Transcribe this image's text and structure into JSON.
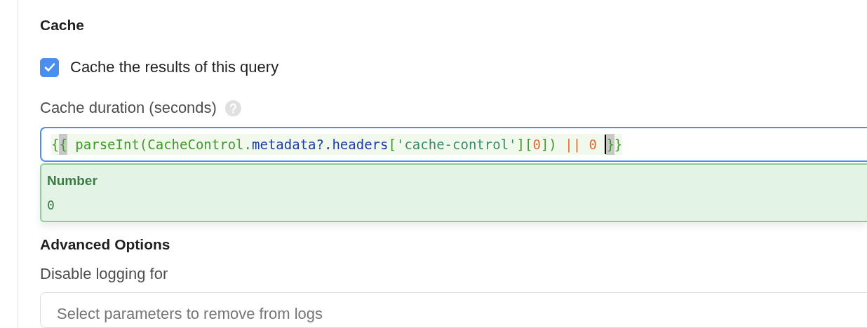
{
  "cache_section": {
    "heading": "Cache",
    "checkbox": {
      "label": "Cache the results of this query",
      "checked": true
    },
    "duration": {
      "label": "Cache duration (seconds)",
      "tokens": [
        {
          "text": "{",
          "kind": "brace",
          "matched": false,
          "cursor_before": false
        },
        {
          "text": "{",
          "kind": "brace",
          "matched": true,
          "cursor_before": false
        },
        {
          "text": " parseInt(CacheControl.",
          "kind": "plain",
          "matched": false,
          "cursor_before": false
        },
        {
          "text": "metadata?.headers",
          "kind": "property",
          "matched": false,
          "cursor_before": false
        },
        {
          "text": "[",
          "kind": "plain",
          "matched": false,
          "cursor_before": false
        },
        {
          "text": "'cache-control'",
          "kind": "string",
          "matched": false,
          "cursor_before": false
        },
        {
          "text": "][",
          "kind": "plain",
          "matched": false,
          "cursor_before": false
        },
        {
          "text": "0",
          "kind": "number",
          "matched": false,
          "cursor_before": false
        },
        {
          "text": "])",
          "kind": "plain",
          "matched": false,
          "cursor_before": false
        },
        {
          "text": " || 0 ",
          "kind": "operator",
          "matched": false,
          "cursor_before": false
        },
        {
          "text": "}",
          "kind": "brace",
          "matched": true,
          "cursor_before": true
        },
        {
          "text": "}",
          "kind": "brace",
          "matched": false,
          "cursor_before": false
        }
      ],
      "result": {
        "type": "Number",
        "value": "0"
      }
    }
  },
  "advanced_section": {
    "heading": "Advanced Options",
    "logging": {
      "label": "Disable logging for",
      "placeholder": "Select parameters to remove from logs"
    }
  }
}
